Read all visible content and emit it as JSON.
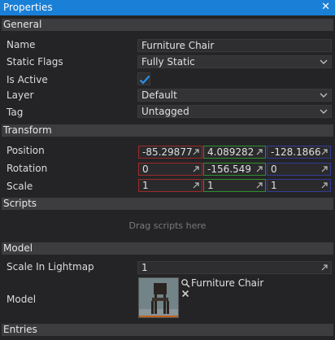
{
  "window": {
    "title": "Properties"
  },
  "general": {
    "header": "General",
    "name_label": "Name",
    "name_value": "Furniture Chair",
    "static_flags_label": "Static Flags",
    "static_flags_value": "Fully Static",
    "is_active_label": "Is Active",
    "is_active_checked": true,
    "layer_label": "Layer",
    "layer_value": "Default",
    "tag_label": "Tag",
    "tag_value": "Untagged"
  },
  "transform": {
    "header": "Transform",
    "position_label": "Position",
    "position": {
      "x": "-85.29877",
      "y": "4.089282",
      "z": "-128.1866"
    },
    "rotation_label": "Rotation",
    "rotation": {
      "x": "0",
      "y": "-156.549",
      "z": "0"
    },
    "scale_label": "Scale",
    "scale": {
      "x": "1",
      "y": "1",
      "z": "1"
    }
  },
  "scripts": {
    "header": "Scripts",
    "drop_hint": "Drag scripts here"
  },
  "model": {
    "header": "Model",
    "scale_in_lightmap_label": "Scale In Lightmap",
    "scale_in_lightmap_value": "1",
    "model_label": "Model",
    "model_asset_name": "Furniture Chair"
  },
  "entries": {
    "header": "Entries"
  },
  "colors": {
    "accent": "#1a7fd6",
    "axis_x": "#9c2a2a",
    "axis_y": "#2f8f2f",
    "axis_z": "#343a99"
  }
}
